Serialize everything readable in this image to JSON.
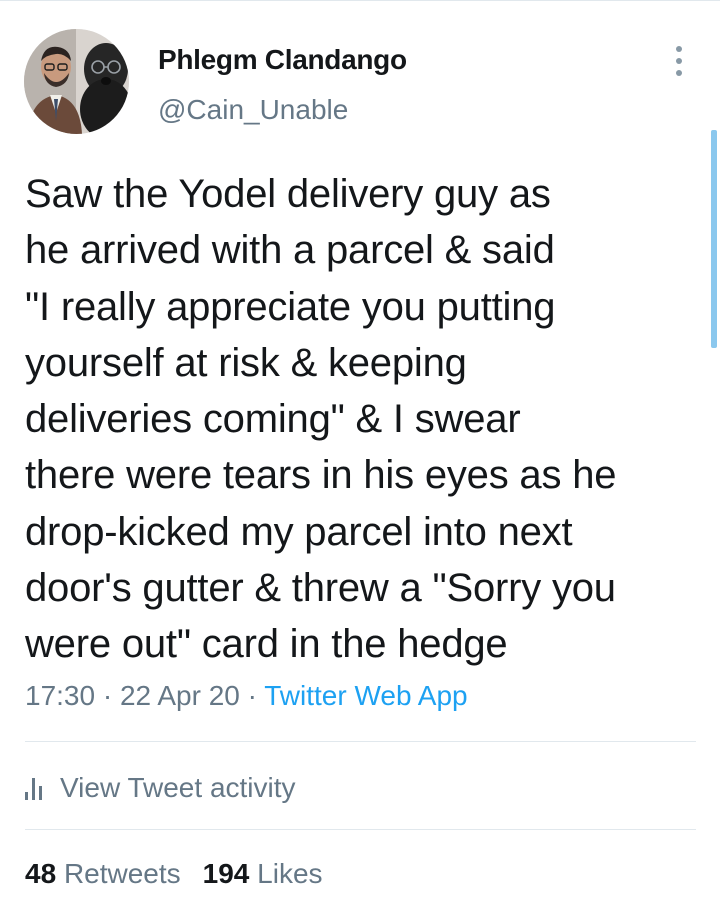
{
  "tweet": {
    "author": {
      "display_name": "Phlegm Clandango",
      "handle": "@Cain_Unable"
    },
    "text": "Saw the Yodel delivery guy as\nhe arrived with a parcel & said\n\"I really appreciate you putting\nyourself at risk & keeping\ndeliveries coming\" & I swear\nthere were tears in his eyes as he\ndrop-kicked my parcel into next\ndoor's gutter & threw a \"Sorry you\nwere out\" card in the hedge",
    "time": "17:30",
    "date": "22 Apr 20",
    "separator": "·",
    "source": "Twitter Web App"
  },
  "activity": {
    "label": "View Tweet activity",
    "icon": "bar-chart-icon"
  },
  "stats": {
    "retweets_count": "48",
    "retweets_label": "Retweets",
    "likes_count": "194",
    "likes_label": "Likes"
  },
  "colors": {
    "text": "#14171a",
    "secondary": "#657786",
    "link": "#1da1f2",
    "divider": "#e1e8ed"
  }
}
